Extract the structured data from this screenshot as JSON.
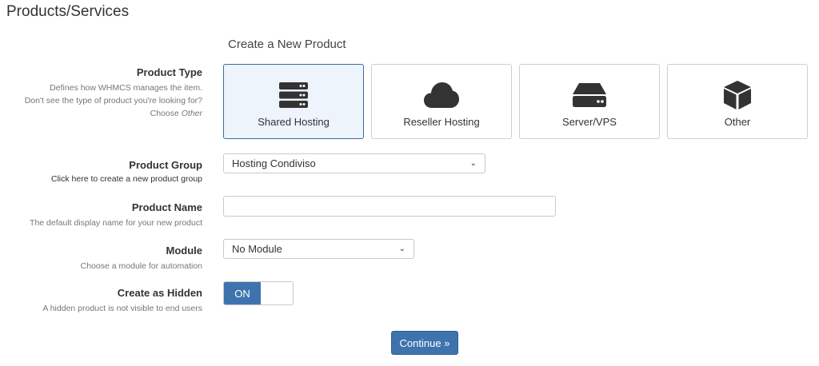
{
  "page": {
    "title": "Products/Services",
    "section_title": "Create a New Product"
  },
  "product_type": {
    "label": "Product Type",
    "help_line1": "Defines how WHMCS manages the item.",
    "help_line2": "Don't see the type of product you're looking for?",
    "help_line3_prefix": "Choose ",
    "help_line3_emph": "Other",
    "options": [
      {
        "label": "Shared Hosting",
        "icon": "server-stack-icon",
        "selected": true
      },
      {
        "label": "Reseller Hosting",
        "icon": "cloud-icon",
        "selected": false
      },
      {
        "label": "Server/VPS",
        "icon": "hard-drive-icon",
        "selected": false
      },
      {
        "label": "Other",
        "icon": "box-icon",
        "selected": false
      }
    ]
  },
  "product_group": {
    "label": "Product Group",
    "help_link": "Click here to create a new product group",
    "selected": "Hosting Condiviso"
  },
  "product_name": {
    "label": "Product Name",
    "help": "The default display name for your new product",
    "value": "",
    "placeholder": ""
  },
  "module": {
    "label": "Module",
    "help": "Choose a module for automation",
    "selected": "No Module"
  },
  "hidden": {
    "label": "Create as Hidden",
    "help": "A hidden product is not visible to end users",
    "state_label": "ON"
  },
  "actions": {
    "continue_label": "Continue »"
  },
  "colors": {
    "accent": "#3f73ad",
    "selected_card_bg": "#eef4fb"
  }
}
